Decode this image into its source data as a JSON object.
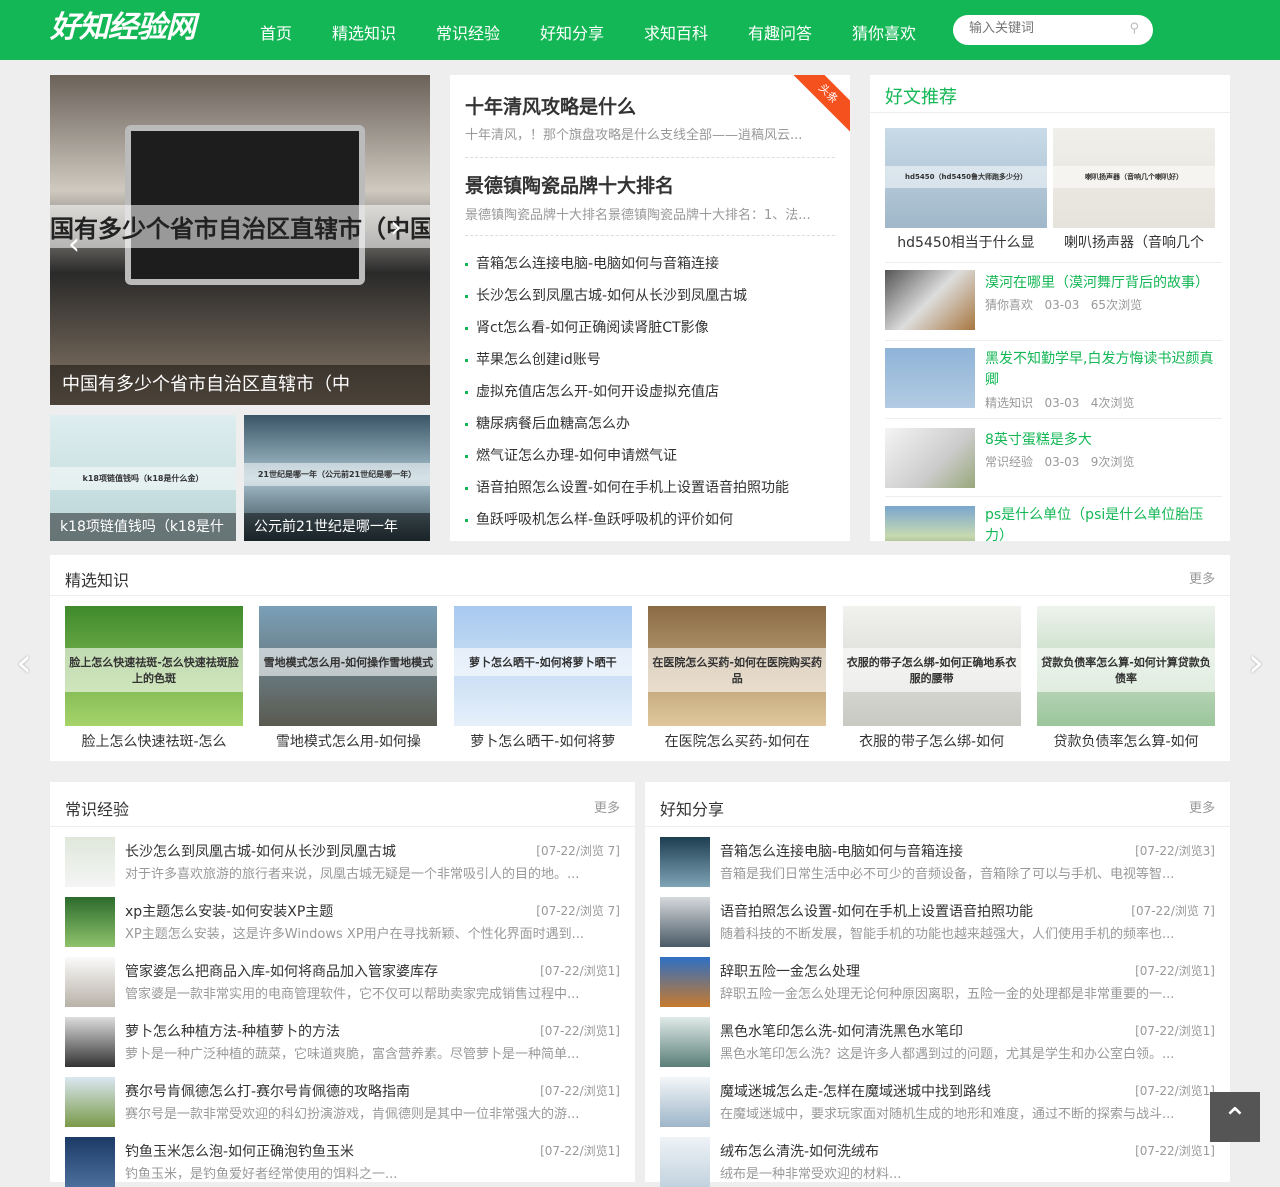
{
  "header": {
    "logo": "好知经验网",
    "nav": [
      "首页",
      "精选知识",
      "常识经验",
      "好知分享",
      "求知百科",
      "有趣问答",
      "猜你喜欢"
    ],
    "search_placeholder": "输入关键词"
  },
  "slider": {
    "overlay": "国有多少个省市自治区直辖市（中国有多少个省市）",
    "caption": "中国有多少个省市自治区直辖市（中",
    "thumbs": [
      {
        "caption": "k18项链值钱吗（k18是什",
        "overlay": "k18项链值钱吗（k18是什么金）"
      },
      {
        "caption": "公元前21世纪是哪一年",
        "overlay": "21世纪是哪一年（公元前21世纪是哪一年）"
      }
    ]
  },
  "headlines": {
    "badge": "头条",
    "items": [
      {
        "title": "十年清风攻略是什么",
        "desc": "十年清风，！那个旗盘攻略是什么支线全部——逍稿风云..."
      },
      {
        "title": "景德镇陶瓷品牌十大排名",
        "desc": "景德镇陶瓷品牌十大排名景德镇陶瓷品牌十大排名：1、法..."
      }
    ],
    "list": [
      "音箱怎么连接电脑-电脑如何与音箱连接",
      "长沙怎么到凤凰古城-如何从长沙到凤凰古城",
      "肾ct怎么看-如何正确阅读肾脏CT影像",
      "苹果怎么创建id账号",
      "虚拟充值店怎么开-如何开设虚拟充值店",
      "糖尿病餐后血糖高怎么办",
      "燃气证怎么办理-如何申请燃气证",
      "语音拍照怎么设置-如何在手机上设置语音拍照功能",
      "鱼跃呼吸机怎么样-鱼跃呼吸机的评价如何"
    ]
  },
  "recommend": {
    "title": "好文推荐",
    "grid": [
      {
        "caption": "hd5450相当于什么显",
        "overlay": "hd5450（hd5450鲁大师跑多少分）"
      },
      {
        "caption": "喇叭扬声器（音响几个",
        "overlay": "喇叭扬声器（音响几个喇叭好）"
      }
    ],
    "list": [
      {
        "title": "漠河在哪里（漠河舞厅背后的故事）",
        "cat": "猜你喜欢",
        "date": "03-03",
        "views": "65次浏览"
      },
      {
        "title": "黑发不知勤学早,白发方悔读书迟颜真卿",
        "cat": "精选知识",
        "date": "03-03",
        "views": "4次浏览"
      },
      {
        "title": "8英寸蛋糕是多大",
        "cat": "常识经验",
        "date": "03-03",
        "views": "9次浏览"
      },
      {
        "title": "ps是什么单位（psi是什么单位胎压力）",
        "cat": "",
        "date": "",
        "views": ""
      }
    ]
  },
  "featured": {
    "title": "精选知识",
    "more": "更多",
    "items": [
      {
        "overlay": "脸上怎么快速祛斑-怎么快速祛斑脸上的色斑",
        "caption": "脸上怎么快速祛斑-怎么"
      },
      {
        "overlay": "雪地模式怎么用-如何操作雪地模式",
        "caption": "雪地模式怎么用-如何操"
      },
      {
        "overlay": "萝卜怎么晒干-如何将萝卜晒干",
        "caption": "萝卜怎么晒干-如何将萝"
      },
      {
        "overlay": "在医院怎么买药-如何在医院购买药品",
        "caption": "在医院怎么买药-如何在"
      },
      {
        "overlay": "衣服的带子怎么绑-如何正确地系衣服的腰带",
        "caption": "衣服的带子怎么绑-如何"
      },
      {
        "overlay": "贷款负债率怎么算-如何计算贷款负债率",
        "caption": "贷款负债率怎么算-如何"
      }
    ]
  },
  "common": {
    "title": "常识经验",
    "more": "更多",
    "rows": [
      {
        "title": "长沙怎么到凤凰古城-如何从长沙到凤凰古城",
        "desc": "对于许多喜欢旅游的旅行者来说，凤凰古城无疑是一个非常吸引人的目的地。...",
        "meta": "[07-22/浏览 7]"
      },
      {
        "title": "xp主题怎么安装-如何安装XP主题",
        "desc": "XP主题怎么安装，这是许多Windows XP用户在寻找新颖、个性化界面时遇到...",
        "meta": "[07-22/浏览 7]"
      },
      {
        "title": "管家婆怎么把商品入库-如何将商品加入管家婆库存",
        "desc": "管家婆是一款非常实用的电商管理软件，它不仅可以帮助卖家完成销售过程中...",
        "meta": "[07-22/浏览1]"
      },
      {
        "title": "萝卜怎么种植方法-种植萝卜的方法",
        "desc": "萝卜是一种广泛种植的蔬菜，它味道爽脆，富含营养素。尽管萝卜是一种简单...",
        "meta": "[07-22/浏览1]"
      },
      {
        "title": "赛尔号肯佩德怎么打-赛尔号肯佩德的攻略指南",
        "desc": "赛尔号是一款非常受欢迎的科幻扮演游戏，肯佩德则是其中一位非常强大的游...",
        "meta": "[07-22/浏览1]"
      },
      {
        "title": "钓鱼玉米怎么泡-如何正确泡钓鱼玉米",
        "desc": "钓鱼玉米，是钓鱼爱好者经常使用的饵料之一...",
        "meta": "[07-22/浏览1]"
      }
    ]
  },
  "share": {
    "title": "好知分享",
    "more": "更多",
    "rows": [
      {
        "title": "音箱怎么连接电脑-电脑如何与音箱连接",
        "desc": "音箱是我们日常生活中必不可少的音频设备，音箱除了可以与手机、电视等智...",
        "meta": "[07-22/浏览3]"
      },
      {
        "title": "语音拍照怎么设置-如何在手机上设置语音拍照功能",
        "desc": "随着科技的不断发展，智能手机的功能也越来越强大，人们使用手机的频率也...",
        "meta": "[07-22/浏览 7]"
      },
      {
        "title": "辞职五险一金怎么处理",
        "desc": "辞职五险一金怎么处理无论何种原因离职，五险一金的处理都是非常重要的一...",
        "meta": "[07-22/浏览1]"
      },
      {
        "title": "黑色水笔印怎么洗-如何清洗黑色水笔印",
        "desc": "黑色水笔印怎么洗？这是许多人都遇到过的问题，尤其是学生和办公室白领。...",
        "meta": "[07-22/浏览1]"
      },
      {
        "title": "魔域迷城怎么走-怎样在魔域迷城中找到路线",
        "desc": "在魔域迷城中，要求玩家面对随机生成的地形和难度，通过不断的探索与战斗...",
        "meta": "[07-22/浏览1]"
      },
      {
        "title": "绒布怎么清洗-如何洗绒布",
        "desc": "绒布是一种非常受欢迎的材料...",
        "meta": "[07-22/浏览1]"
      }
    ]
  }
}
